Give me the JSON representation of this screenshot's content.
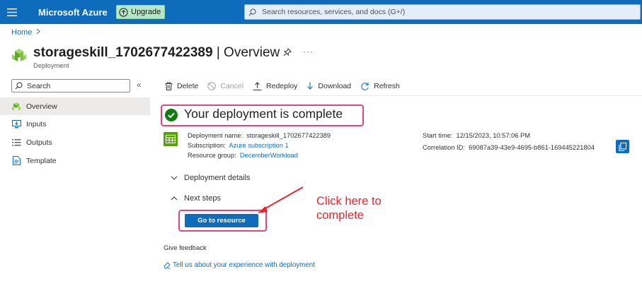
{
  "topbar": {
    "brand": "Microsoft Azure",
    "upgrade_label": "Upgrade",
    "search_placeholder": "Search resources, services, and docs (G+/)",
    "color": "#0f6cbd"
  },
  "breadcrumb": {
    "home": "Home"
  },
  "header": {
    "resource_name": "storageskill_1702677422389",
    "separator": " | ",
    "page": "Overview",
    "subtitle": "Deployment",
    "more": "···"
  },
  "nav": {
    "search_placeholder": "Search",
    "collapse": "«",
    "items": [
      {
        "label": "Overview",
        "icon": "overview-icon"
      },
      {
        "label": "Inputs",
        "icon": "inputs-icon"
      },
      {
        "label": "Outputs",
        "icon": "outputs-icon"
      },
      {
        "label": "Template",
        "icon": "template-icon"
      }
    ]
  },
  "toolbar": {
    "delete": "Delete",
    "cancel": "Cancel",
    "redeploy": "Redeploy",
    "download": "Download",
    "refresh": "Refresh"
  },
  "status": {
    "message": "Your deployment is complete",
    "color": "#107c10"
  },
  "details": {
    "deployment_name_label": "Deployment name:",
    "deployment_name": "storageskill_1702677422389",
    "subscription_label": "Subscription:",
    "subscription": "Azure subscription 1",
    "resource_group_label": "Resource group:",
    "resource_group": "DecemberWorkload",
    "start_time_label": "Start time:",
    "start_time": "12/15/2023, 10:57:06 PM",
    "correlation_label": "Correlation ID:",
    "correlation_id": "69087a39-43e9-4695-b861-169445221804"
  },
  "sections": {
    "deployment_details": "Deployment details",
    "next_steps": "Next steps"
  },
  "goto_button": "Go to resource",
  "annotation": {
    "line1": "Click here to",
    "line2": "complete",
    "color": "#e8242c"
  },
  "feedback": {
    "title": "Give feedback",
    "link": "Tell us about your experience with deployment"
  }
}
